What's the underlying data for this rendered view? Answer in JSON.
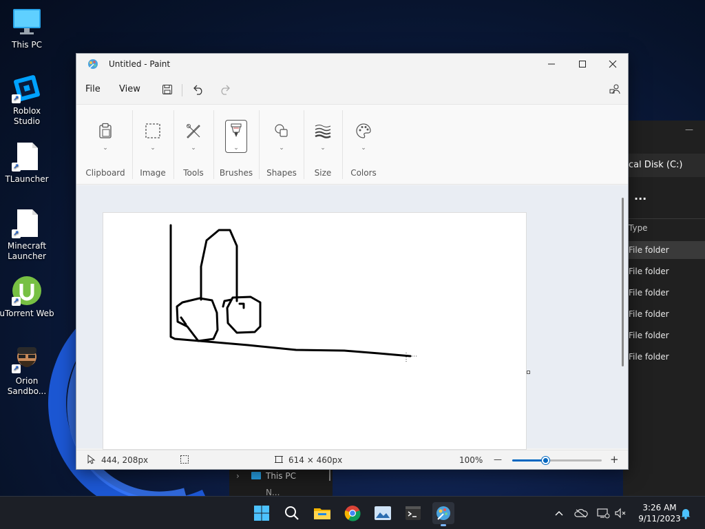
{
  "desktop": {
    "icons": [
      {
        "label": "This PC",
        "icon": "monitor-icon"
      },
      {
        "label": "Roblox Studio",
        "icon": "roblox-studio-icon"
      },
      {
        "label": "TLauncher",
        "icon": "file-icon"
      },
      {
        "label": "Minecraft Launcher",
        "icon": "file-icon"
      },
      {
        "label": "uTorrent Web",
        "icon": "utorrent-icon"
      },
      {
        "label": "Orion Sandbo...",
        "icon": "orion-sandbox-icon"
      }
    ]
  },
  "explorer": {
    "path": "ocal Disk (C:)",
    "more_label": "···",
    "column_type": "Type",
    "rows": [
      "File folder",
      "File folder",
      "File folder",
      "File folder",
      "File folder",
      "File folder"
    ],
    "nav_item": "This PC",
    "nav_item2": "N..."
  },
  "paint": {
    "title": "Untitled - Paint",
    "menu": {
      "file": "File",
      "view": "View"
    },
    "ribbon": [
      {
        "label": "Clipboard",
        "icon": "clipboard-icon"
      },
      {
        "label": "Image",
        "icon": "selection-icon"
      },
      {
        "label": "Tools",
        "icon": "tools-icon"
      },
      {
        "label": "Brushes",
        "icon": "brush-icon"
      },
      {
        "label": "Shapes",
        "icon": "shapes-icon"
      },
      {
        "label": "Size",
        "icon": "size-icon"
      },
      {
        "label": "Colors",
        "icon": "palette-icon"
      }
    ],
    "status": {
      "cursor_pos": "444, 208px",
      "canvas_size": "614 × 460px",
      "zoom": "100%",
      "zoom_minus": "—",
      "zoom_plus": "+",
      "zoom_slider_fraction": 0.38
    }
  },
  "taskbar": {
    "time": "3:26 AM",
    "date": "9/11/2023",
    "apps": [
      "start-icon",
      "search-icon",
      "file-explorer-icon",
      "chrome-icon",
      "photos-icon",
      "terminal-icon",
      "paint-icon"
    ]
  },
  "colors": {
    "accent": "#0067c0",
    "taskbar": "#1c1f26"
  }
}
